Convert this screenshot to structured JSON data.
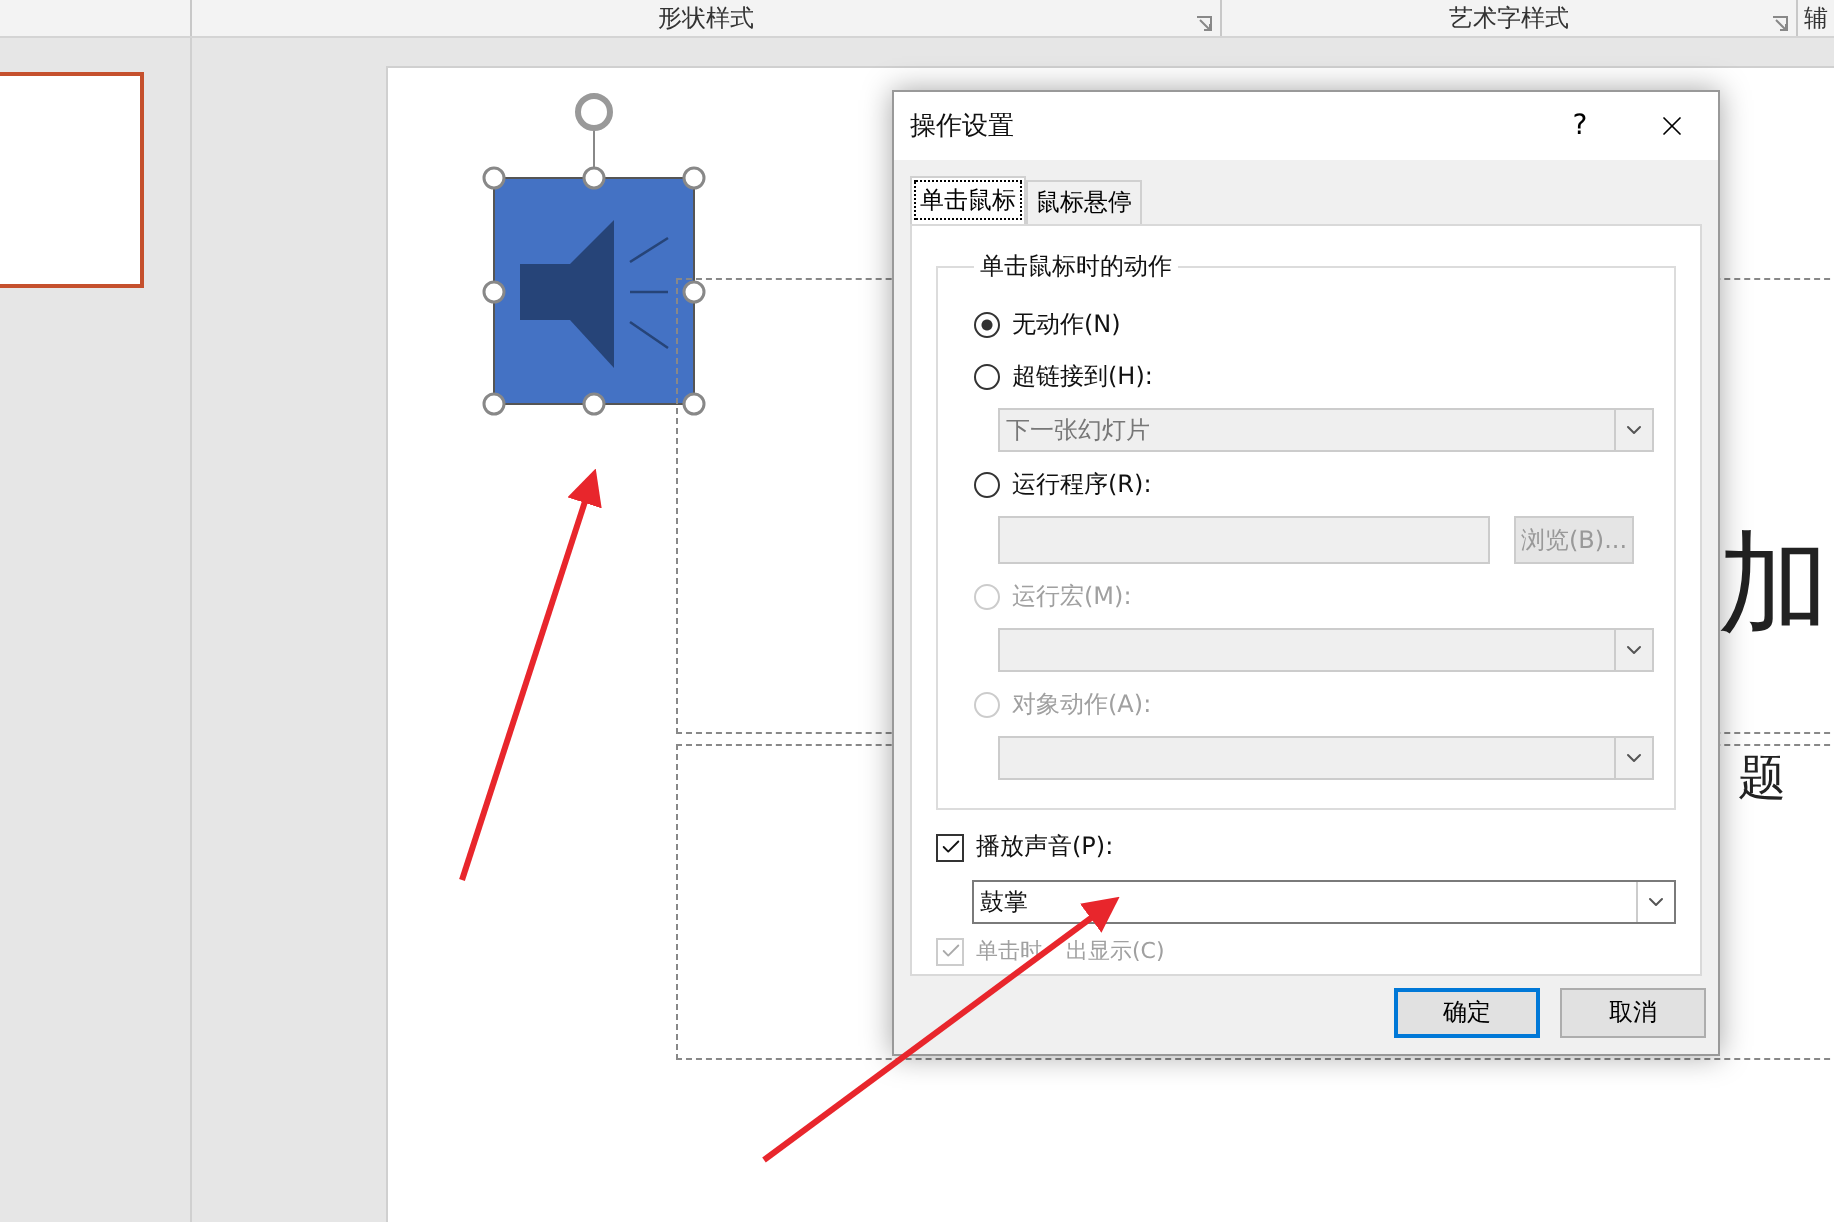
{
  "ribbon": {
    "groups": [
      {
        "label": "形状样式",
        "launcher": true
      },
      {
        "label": "艺术字样式",
        "launcher": true
      },
      {
        "label": "辅",
        "launcher": false
      }
    ]
  },
  "slides": [
    {
      "selected": true
    }
  ],
  "slide": {
    "title_text": "加",
    "subtitle_text": "题",
    "audio_icon": {
      "selected": true
    }
  },
  "dialog": {
    "title": "操作设置",
    "help": "?",
    "tabs": [
      {
        "label": "单击鼠标",
        "selected": true
      },
      {
        "label": "鼠标悬停",
        "selected": false
      }
    ],
    "group_title": "单击鼠标时的动作",
    "options": [
      {
        "kind": "radio",
        "label": "无动作(N)",
        "selected": true,
        "disabled": false
      },
      {
        "kind": "radio",
        "label": "超链接到(H):",
        "selected": false,
        "disabled": false,
        "field": {
          "kind": "select",
          "value": "下一张幻灯片",
          "disabled": true
        }
      },
      {
        "kind": "radio",
        "label": "运行程序(R):",
        "selected": false,
        "disabled": false,
        "field": {
          "kind": "text",
          "disabled": true,
          "button": "浏览(B)..."
        }
      },
      {
        "kind": "radio",
        "label": "运行宏(M):",
        "selected": false,
        "disabled": true,
        "field": {
          "kind": "select",
          "disabled": true
        }
      },
      {
        "kind": "radio",
        "label": "对象动作(A):",
        "selected": false,
        "disabled": true,
        "field": {
          "kind": "select",
          "disabled": true
        }
      }
    ],
    "play_sound": {
      "label": "播放声音(P):",
      "checked": true,
      "value": "鼓掌"
    },
    "highlight": {
      "label_parts": [
        "单击时",
        "出显示(C)"
      ],
      "checked": true,
      "disabled": true
    },
    "buttons": [
      {
        "label": "确定",
        "default": true
      },
      {
        "label": "取消",
        "default": false
      }
    ]
  }
}
